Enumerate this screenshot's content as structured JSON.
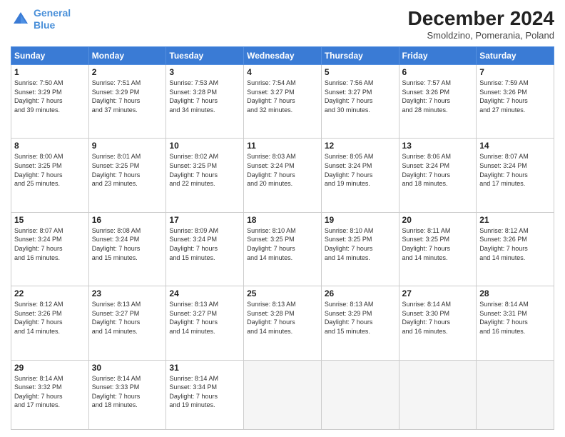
{
  "header": {
    "logo_line1": "General",
    "logo_line2": "Blue",
    "month_title": "December 2024",
    "subtitle": "Smoldzino, Pomerania, Poland"
  },
  "days_of_week": [
    "Sunday",
    "Monday",
    "Tuesday",
    "Wednesday",
    "Thursday",
    "Friday",
    "Saturday"
  ],
  "weeks": [
    [
      {
        "day": "1",
        "info": "Sunrise: 7:50 AM\nSunset: 3:29 PM\nDaylight: 7 hours\nand 39 minutes."
      },
      {
        "day": "2",
        "info": "Sunrise: 7:51 AM\nSunset: 3:29 PM\nDaylight: 7 hours\nand 37 minutes."
      },
      {
        "day": "3",
        "info": "Sunrise: 7:53 AM\nSunset: 3:28 PM\nDaylight: 7 hours\nand 34 minutes."
      },
      {
        "day": "4",
        "info": "Sunrise: 7:54 AM\nSunset: 3:27 PM\nDaylight: 7 hours\nand 32 minutes."
      },
      {
        "day": "5",
        "info": "Sunrise: 7:56 AM\nSunset: 3:27 PM\nDaylight: 7 hours\nand 30 minutes."
      },
      {
        "day": "6",
        "info": "Sunrise: 7:57 AM\nSunset: 3:26 PM\nDaylight: 7 hours\nand 28 minutes."
      },
      {
        "day": "7",
        "info": "Sunrise: 7:59 AM\nSunset: 3:26 PM\nDaylight: 7 hours\nand 27 minutes."
      }
    ],
    [
      {
        "day": "8",
        "info": "Sunrise: 8:00 AM\nSunset: 3:25 PM\nDaylight: 7 hours\nand 25 minutes."
      },
      {
        "day": "9",
        "info": "Sunrise: 8:01 AM\nSunset: 3:25 PM\nDaylight: 7 hours\nand 23 minutes."
      },
      {
        "day": "10",
        "info": "Sunrise: 8:02 AM\nSunset: 3:25 PM\nDaylight: 7 hours\nand 22 minutes."
      },
      {
        "day": "11",
        "info": "Sunrise: 8:03 AM\nSunset: 3:24 PM\nDaylight: 7 hours\nand 20 minutes."
      },
      {
        "day": "12",
        "info": "Sunrise: 8:05 AM\nSunset: 3:24 PM\nDaylight: 7 hours\nand 19 minutes."
      },
      {
        "day": "13",
        "info": "Sunrise: 8:06 AM\nSunset: 3:24 PM\nDaylight: 7 hours\nand 18 minutes."
      },
      {
        "day": "14",
        "info": "Sunrise: 8:07 AM\nSunset: 3:24 PM\nDaylight: 7 hours\nand 17 minutes."
      }
    ],
    [
      {
        "day": "15",
        "info": "Sunrise: 8:07 AM\nSunset: 3:24 PM\nDaylight: 7 hours\nand 16 minutes."
      },
      {
        "day": "16",
        "info": "Sunrise: 8:08 AM\nSunset: 3:24 PM\nDaylight: 7 hours\nand 15 minutes."
      },
      {
        "day": "17",
        "info": "Sunrise: 8:09 AM\nSunset: 3:24 PM\nDaylight: 7 hours\nand 15 minutes."
      },
      {
        "day": "18",
        "info": "Sunrise: 8:10 AM\nSunset: 3:25 PM\nDaylight: 7 hours\nand 14 minutes."
      },
      {
        "day": "19",
        "info": "Sunrise: 8:10 AM\nSunset: 3:25 PM\nDaylight: 7 hours\nand 14 minutes."
      },
      {
        "day": "20",
        "info": "Sunrise: 8:11 AM\nSunset: 3:25 PM\nDaylight: 7 hours\nand 14 minutes."
      },
      {
        "day": "21",
        "info": "Sunrise: 8:12 AM\nSunset: 3:26 PM\nDaylight: 7 hours\nand 14 minutes."
      }
    ],
    [
      {
        "day": "22",
        "info": "Sunrise: 8:12 AM\nSunset: 3:26 PM\nDaylight: 7 hours\nand 14 minutes."
      },
      {
        "day": "23",
        "info": "Sunrise: 8:13 AM\nSunset: 3:27 PM\nDaylight: 7 hours\nand 14 minutes."
      },
      {
        "day": "24",
        "info": "Sunrise: 8:13 AM\nSunset: 3:27 PM\nDaylight: 7 hours\nand 14 minutes."
      },
      {
        "day": "25",
        "info": "Sunrise: 8:13 AM\nSunset: 3:28 PM\nDaylight: 7 hours\nand 14 minutes."
      },
      {
        "day": "26",
        "info": "Sunrise: 8:13 AM\nSunset: 3:29 PM\nDaylight: 7 hours\nand 15 minutes."
      },
      {
        "day": "27",
        "info": "Sunrise: 8:14 AM\nSunset: 3:30 PM\nDaylight: 7 hours\nand 16 minutes."
      },
      {
        "day": "28",
        "info": "Sunrise: 8:14 AM\nSunset: 3:31 PM\nDaylight: 7 hours\nand 16 minutes."
      }
    ],
    [
      {
        "day": "29",
        "info": "Sunrise: 8:14 AM\nSunset: 3:32 PM\nDaylight: 7 hours\nand 17 minutes."
      },
      {
        "day": "30",
        "info": "Sunrise: 8:14 AM\nSunset: 3:33 PM\nDaylight: 7 hours\nand 18 minutes."
      },
      {
        "day": "31",
        "info": "Sunrise: 8:14 AM\nSunset: 3:34 PM\nDaylight: 7 hours\nand 19 minutes."
      },
      {
        "day": "",
        "info": ""
      },
      {
        "day": "",
        "info": ""
      },
      {
        "day": "",
        "info": ""
      },
      {
        "day": "",
        "info": ""
      }
    ]
  ]
}
